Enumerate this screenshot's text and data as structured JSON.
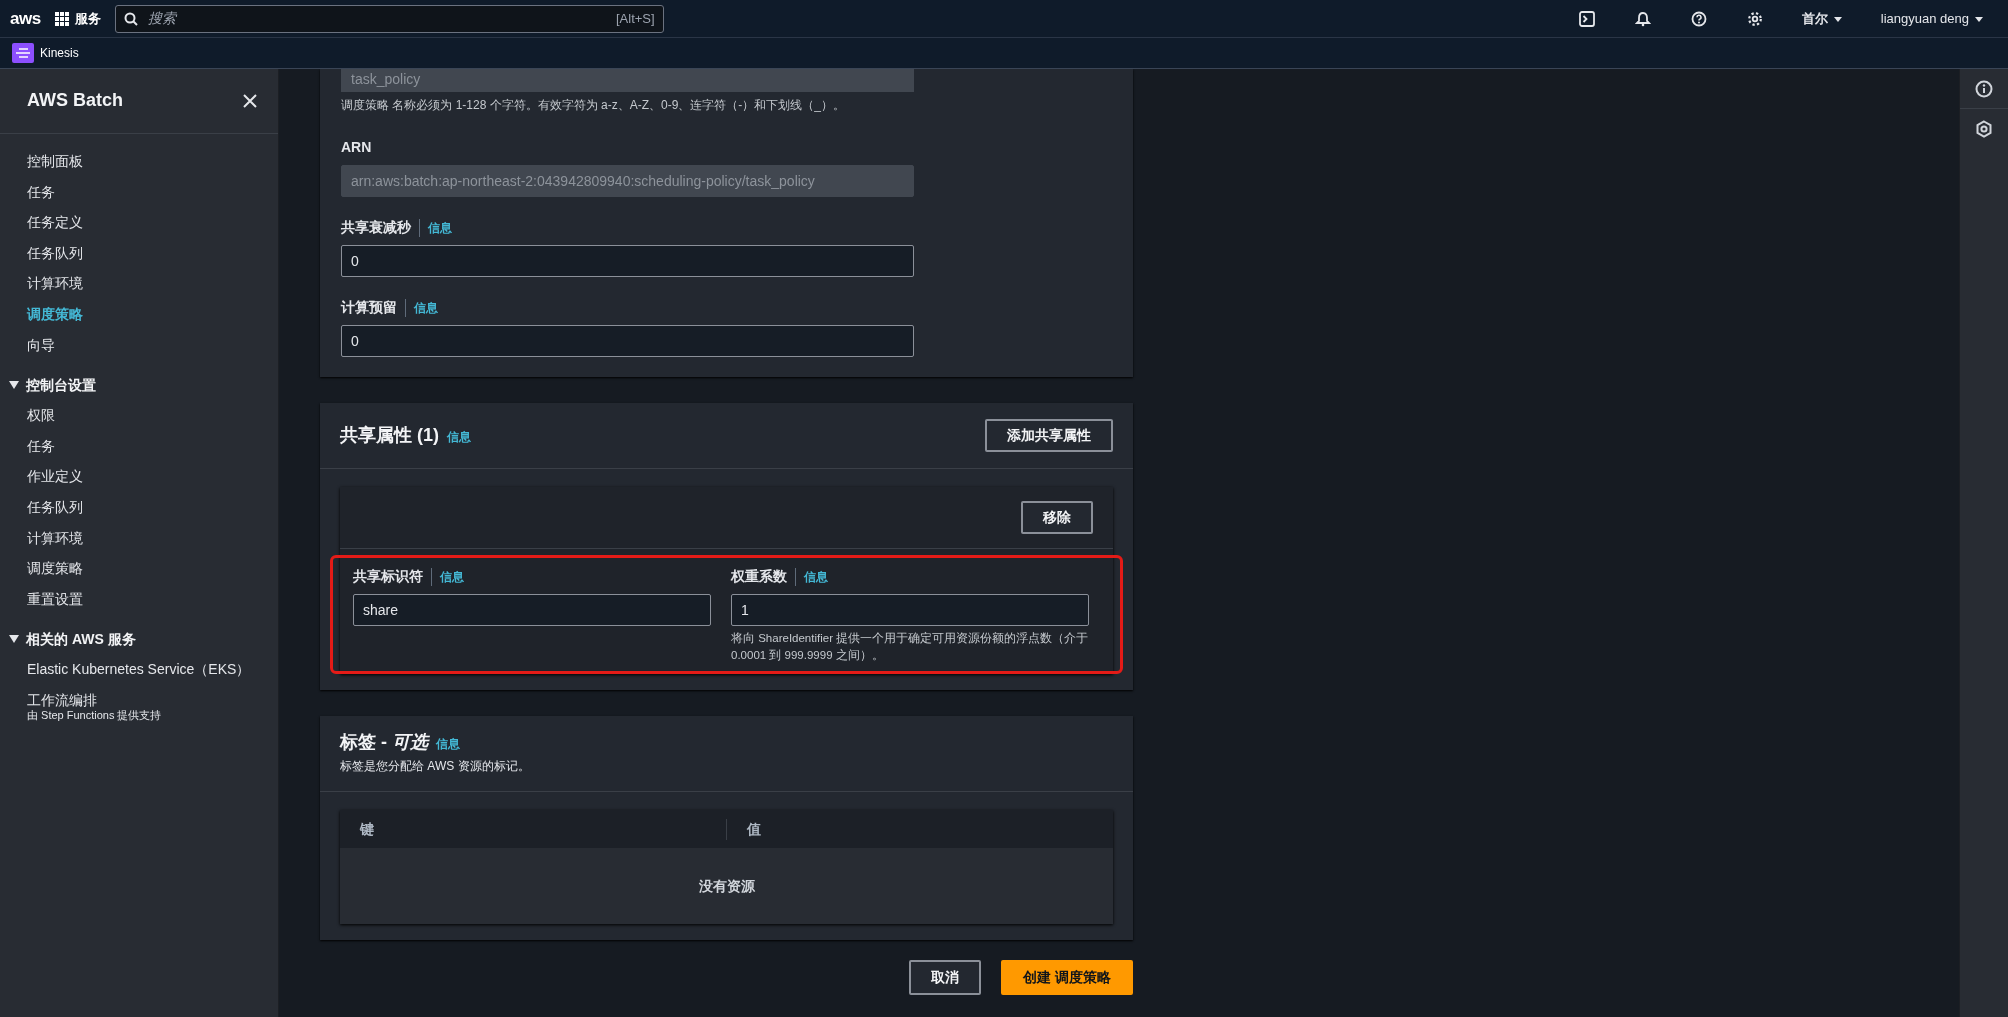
{
  "top_nav": {
    "logo": "aws",
    "services": "服务",
    "search": {
      "placeholder": "搜索",
      "shortcut": "[Alt+S]"
    },
    "region": "首尔",
    "user": "liangyuan deng"
  },
  "favorites": [
    {
      "label": "Kinesis"
    }
  ],
  "sidebar": {
    "title": "AWS Batch",
    "items": [
      {
        "label": "控制面板",
        "selected": false
      },
      {
        "label": "任务",
        "selected": false
      },
      {
        "label": "任务定义",
        "selected": false
      },
      {
        "label": "任务队列",
        "selected": false
      },
      {
        "label": "计算环境",
        "selected": false
      },
      {
        "label": "调度策略",
        "selected": true
      },
      {
        "label": "向导",
        "selected": false
      }
    ],
    "sections": [
      {
        "title": "控制台设置",
        "expanded": true,
        "items": [
          {
            "label": "权限",
            "selected": false
          },
          {
            "label": "任务",
            "selected": false
          },
          {
            "label": "作业定义",
            "selected": false
          },
          {
            "label": "任务队列",
            "selected": false
          },
          {
            "label": "计算环境",
            "selected": false
          },
          {
            "label": "调度策略",
            "selected": false
          },
          {
            "label": "重置设置",
            "selected": false
          }
        ]
      },
      {
        "title": "相关的 AWS 服务",
        "expanded": true,
        "items": [
          {
            "label": "Elastic Kubernetes Service（EKS）",
            "selected": false
          },
          {
            "label": "工作流编排",
            "sublabel": "由 Step Functions 提供支持",
            "selected": false
          }
        ]
      }
    ]
  },
  "details": {
    "fields": [
      {
        "value": "task_policy",
        "disabled": true,
        "hint": "调度策略 名称必须为 1-128 个字符。有效字符为 a-z、A-Z、0-9、连字符（-）和下划线（_）。"
      },
      {
        "label": "ARN",
        "value": "arn:aws:batch:ap-northeast-2:043942809940:scheduling-policy/task_policy",
        "disabled": true
      },
      {
        "label": "共享衰减秒",
        "info": "信息",
        "value": "0",
        "disabled": false
      },
      {
        "label": "计算预留",
        "info": "信息",
        "value": "0",
        "disabled": false
      }
    ]
  },
  "share_attributes": {
    "title": "共享属性 (1)",
    "info": "信息",
    "add_button": "添加共享属性",
    "items": [
      {
        "remove_button": "移除",
        "highlighted": true,
        "identifier": {
          "label": "共享标识符",
          "info": "信息",
          "value": "share"
        },
        "weight": {
          "label": "权重系数",
          "info": "信息",
          "value": "1",
          "hint": "将向 ShareIdentifier 提供一个用于确定可用资源份额的浮点数（介于 0.0001 到 999.9999 之间）。"
        }
      }
    ]
  },
  "tags": {
    "title": "标签 - *可选*",
    "info": "信息",
    "description": "标签是您分配给 AWS 资源的标记。",
    "columns": [
      "键",
      "值"
    ],
    "empty": "没有资源"
  },
  "actions": [
    {
      "label": "取消",
      "kind": "secondary"
    },
    {
      "label": "创建 调度策略",
      "kind": "primary"
    }
  ]
}
